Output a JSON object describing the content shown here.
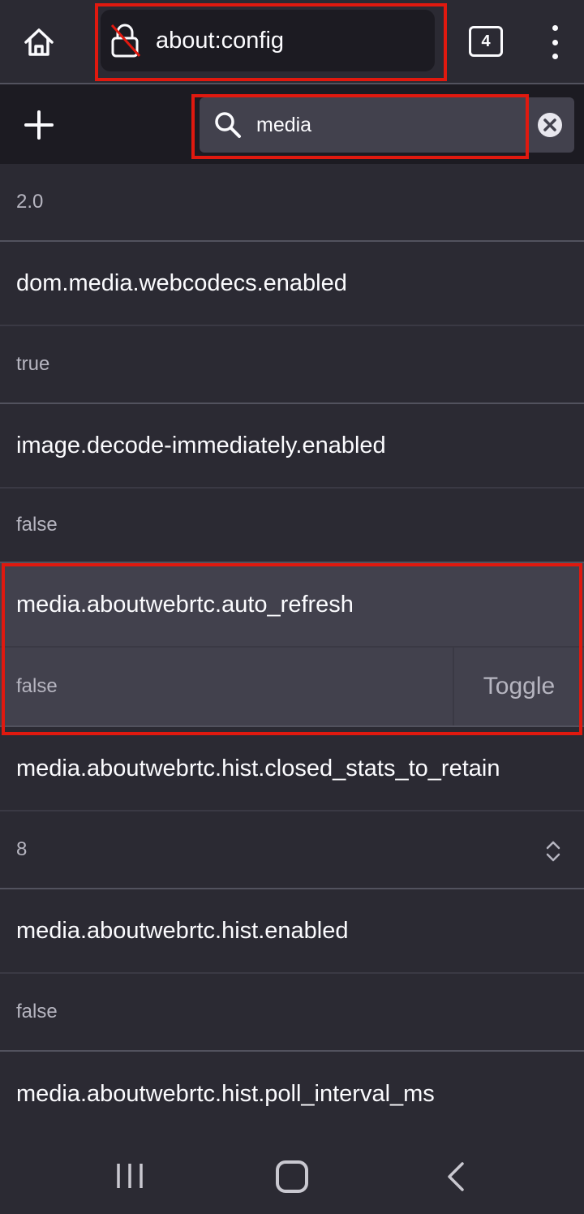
{
  "toolbar": {
    "url": "about:config",
    "tab_count": "4"
  },
  "search": {
    "value": "media"
  },
  "prefs": [
    {
      "type": "value",
      "text": "2.0"
    },
    {
      "type": "name",
      "text": "dom.media.webcodecs.enabled"
    },
    {
      "type": "value",
      "text": "true"
    },
    {
      "type": "name",
      "text": "image.decode-immediately.enabled"
    },
    {
      "type": "value",
      "text": "false"
    },
    {
      "type": "name",
      "text": "media.aboutwebrtc.auto_refresh",
      "selected": true
    },
    {
      "type": "value",
      "text": "false",
      "selected": true,
      "action": "Toggle"
    },
    {
      "type": "name",
      "text": "media.aboutwebrtc.hist.closed_stats_to_retain"
    },
    {
      "type": "value",
      "text": "8",
      "stepper": true
    },
    {
      "type": "name",
      "text": "media.aboutwebrtc.hist.enabled"
    },
    {
      "type": "value",
      "text": "false"
    },
    {
      "type": "name",
      "text": "media.aboutwebrtc.hist.poll_interval_ms"
    }
  ],
  "colors": {
    "background": "#2b2a33",
    "selected_row": "#42414d",
    "highlight": "#e0190f"
  }
}
